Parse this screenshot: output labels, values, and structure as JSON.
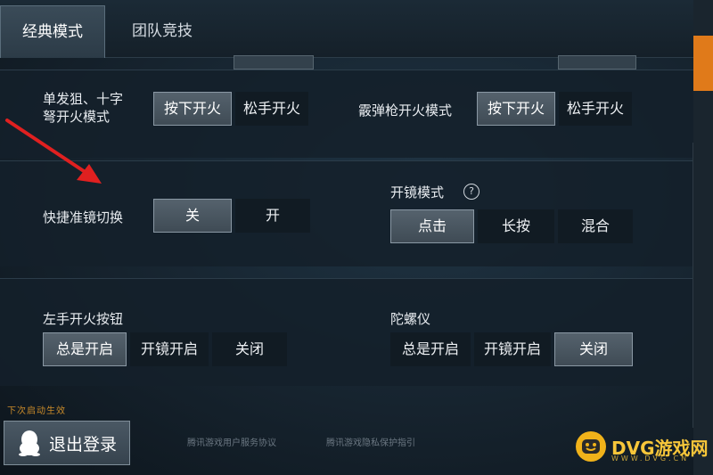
{
  "tabs": [
    {
      "label": "经典模式",
      "active": true
    },
    {
      "label": "团队竞技",
      "active": false
    }
  ],
  "row1": {
    "left_label_line1": "单发狙、十字",
    "left_label_line2": "弩开火模式",
    "left_options": [
      "按下开火",
      "松手开火"
    ],
    "right_label": "霰弹枪开火模式",
    "right_options": [
      "按下开火",
      "松手开火"
    ]
  },
  "row2": {
    "quick_scope_label": "快捷准镜切换",
    "quick_scope_options": [
      "关",
      "开"
    ],
    "scope_mode_label": "开镜模式",
    "help_icon": "?",
    "scope_mode_options": [
      "点击",
      "长按",
      "混合"
    ]
  },
  "row3": {
    "left_fire_label": "左手开火按钮",
    "left_fire_options": [
      "总是开启",
      "开镜开启",
      "关闭"
    ],
    "gyro_label": "陀螺仪",
    "gyro_options": [
      "总是开启",
      "开镜开启",
      "关闭"
    ]
  },
  "warning_text": "下次启动生效",
  "logout_label": "退出登录",
  "footer_links": [
    "腾讯游戏用户服务协议",
    "腾讯游戏隐私保护指引"
  ],
  "brand": {
    "name": "DVG游戏网",
    "url": "WWW.DVG.CN"
  },
  "colors": {
    "accent": "#e07a1a",
    "selected": "#4b5863",
    "brand": "#f0b21a"
  }
}
